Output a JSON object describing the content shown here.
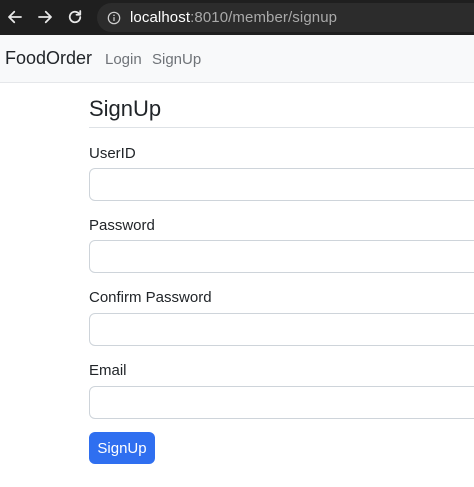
{
  "browser": {
    "url_host": "localhost",
    "url_rest": ":8010/member/signup",
    "back_icon": "back-arrow-icon",
    "forward_icon": "forward-arrow-icon",
    "reload_icon": "reload-icon",
    "info_icon": "info-icon"
  },
  "navbar": {
    "brand": "FoodOrder",
    "links": [
      "Login",
      "SignUp"
    ]
  },
  "form": {
    "title": "SignUp",
    "fields": [
      {
        "label": "UserID",
        "value": ""
      },
      {
        "label": "Password",
        "value": ""
      },
      {
        "label": "Confirm Password",
        "value": ""
      },
      {
        "label": "Email",
        "value": ""
      }
    ],
    "submit_label": "SignUp"
  },
  "colors": {
    "chrome_bg": "#1f1f1f",
    "navbar_bg": "#f8f9fa",
    "primary": "#2f6ff0"
  }
}
